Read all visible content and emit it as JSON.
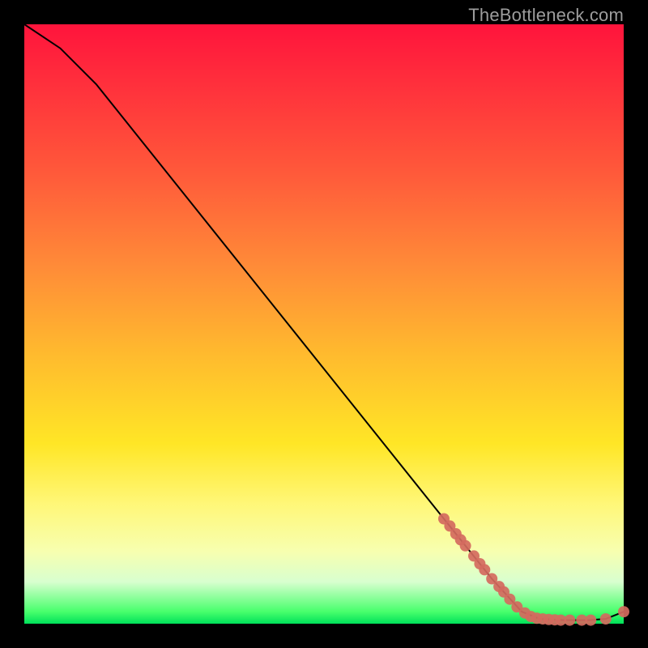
{
  "watermark": "TheBottleneck.com",
  "chart_data": {
    "type": "line",
    "title": "",
    "xlabel": "",
    "ylabel": "",
    "xlim": [
      0,
      100
    ],
    "ylim": [
      0,
      100
    ],
    "curve": [
      {
        "x": 0,
        "y": 100
      },
      {
        "x": 6,
        "y": 96
      },
      {
        "x": 12,
        "y": 90
      },
      {
        "x": 20,
        "y": 80
      },
      {
        "x": 30,
        "y": 67.5
      },
      {
        "x": 40,
        "y": 55
      },
      {
        "x": 50,
        "y": 42.5
      },
      {
        "x": 60,
        "y": 30
      },
      {
        "x": 70,
        "y": 17.5
      },
      {
        "x": 78,
        "y": 7.5
      },
      {
        "x": 83,
        "y": 2
      },
      {
        "x": 86,
        "y": 0.8
      },
      {
        "x": 90,
        "y": 0.6
      },
      {
        "x": 94,
        "y": 0.6
      },
      {
        "x": 97,
        "y": 0.8
      },
      {
        "x": 100,
        "y": 2
      }
    ],
    "marker_color": "#d46a5e",
    "marker_radius_px": 7,
    "markers": [
      {
        "x": 70,
        "y": 17.5
      },
      {
        "x": 71,
        "y": 16.3
      },
      {
        "x": 72,
        "y": 15.0
      },
      {
        "x": 72.8,
        "y": 14.0
      },
      {
        "x": 73.6,
        "y": 13.0
      },
      {
        "x": 75,
        "y": 11.3
      },
      {
        "x": 76,
        "y": 10.0
      },
      {
        "x": 76.8,
        "y": 9.0
      },
      {
        "x": 78,
        "y": 7.5
      },
      {
        "x": 79.2,
        "y": 6.2
      },
      {
        "x": 80,
        "y": 5.3
      },
      {
        "x": 81,
        "y": 4.1
      },
      {
        "x": 82.2,
        "y": 2.8
      },
      {
        "x": 83.5,
        "y": 1.8
      },
      {
        "x": 84.5,
        "y": 1.2
      },
      {
        "x": 85.5,
        "y": 0.9
      },
      {
        "x": 86.5,
        "y": 0.8
      },
      {
        "x": 87.5,
        "y": 0.7
      },
      {
        "x": 88.5,
        "y": 0.65
      },
      {
        "x": 89.5,
        "y": 0.6
      },
      {
        "x": 91,
        "y": 0.6
      },
      {
        "x": 93,
        "y": 0.6
      },
      {
        "x": 94.5,
        "y": 0.6
      },
      {
        "x": 97,
        "y": 0.8
      },
      {
        "x": 100,
        "y": 2.0
      }
    ]
  }
}
